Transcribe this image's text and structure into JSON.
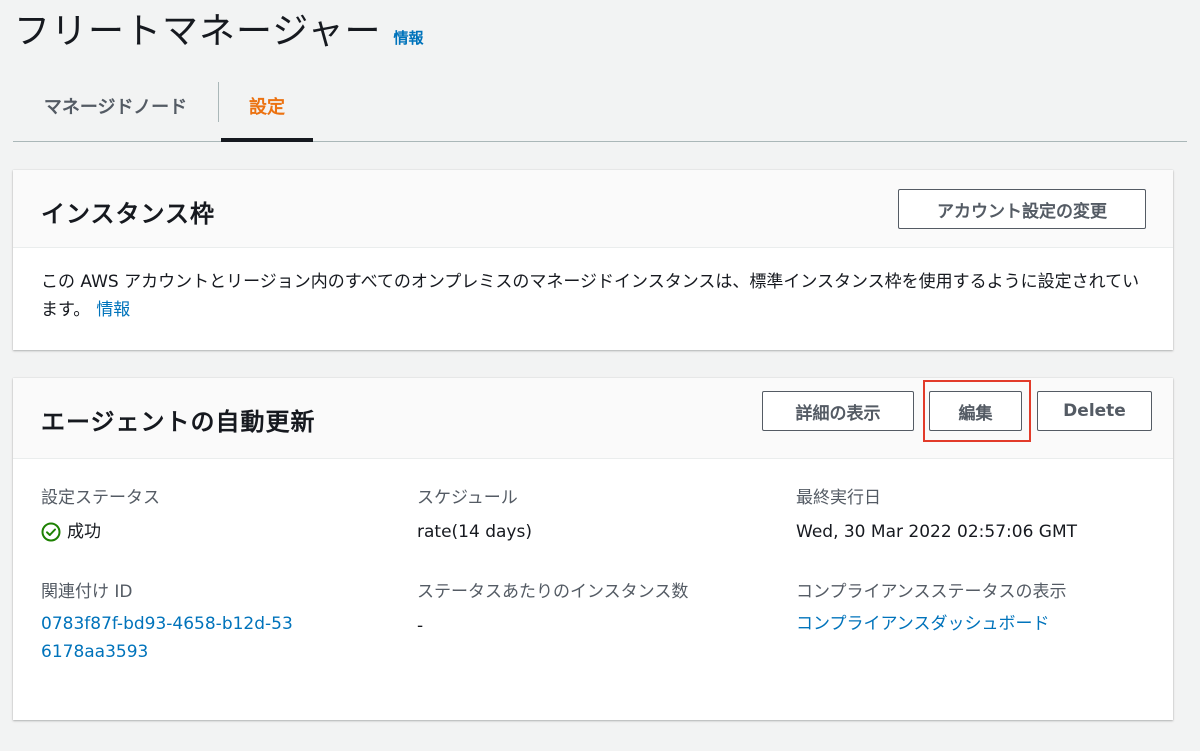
{
  "header": {
    "title": "フリートマネージャー",
    "info_link": "情報"
  },
  "tabs": [
    {
      "label": "マネージドノード",
      "active": false
    },
    {
      "label": "設定",
      "active": true
    }
  ],
  "instance_quota": {
    "title": "インスタンス枠",
    "change_account_button": "アカウント設定の変更",
    "description": "この AWS アカウントとリージョン内のすべてのオンプレミスのマネージドインスタンスは、標準インスタンス枠を使用するように設定されています。",
    "info_link": "情報"
  },
  "agent_auto_update": {
    "title": "エージェントの自動更新",
    "buttons": {
      "details": "詳細の表示",
      "edit": "編集",
      "delete": "Delete"
    },
    "fields": {
      "config_status": {
        "label": "設定ステータス",
        "value": "成功"
      },
      "schedule": {
        "label": "スケジュール",
        "value": "rate(14 days)"
      },
      "last_run": {
        "label": "最終実行日",
        "value": "Wed, 30 Mar 2022 02:57:06 GMT"
      },
      "association_id": {
        "label": "関連付け ID",
        "value": "0783f87f-bd93-4658-b12d-536178aa3593"
      },
      "instances_per_status": {
        "label": "ステータスあたりのインスタンス数",
        "value": "-"
      },
      "compliance": {
        "label": "コンプライアンスステータスの表示",
        "value": "コンプライアンスダッシュボード"
      }
    }
  },
  "colors": {
    "accent_link": "#0073bb",
    "active_tab": "#ec7211",
    "success": "#1d8102",
    "highlight": "#e23b2a"
  },
  "icons": {
    "status_success": "check-circle-icon"
  }
}
